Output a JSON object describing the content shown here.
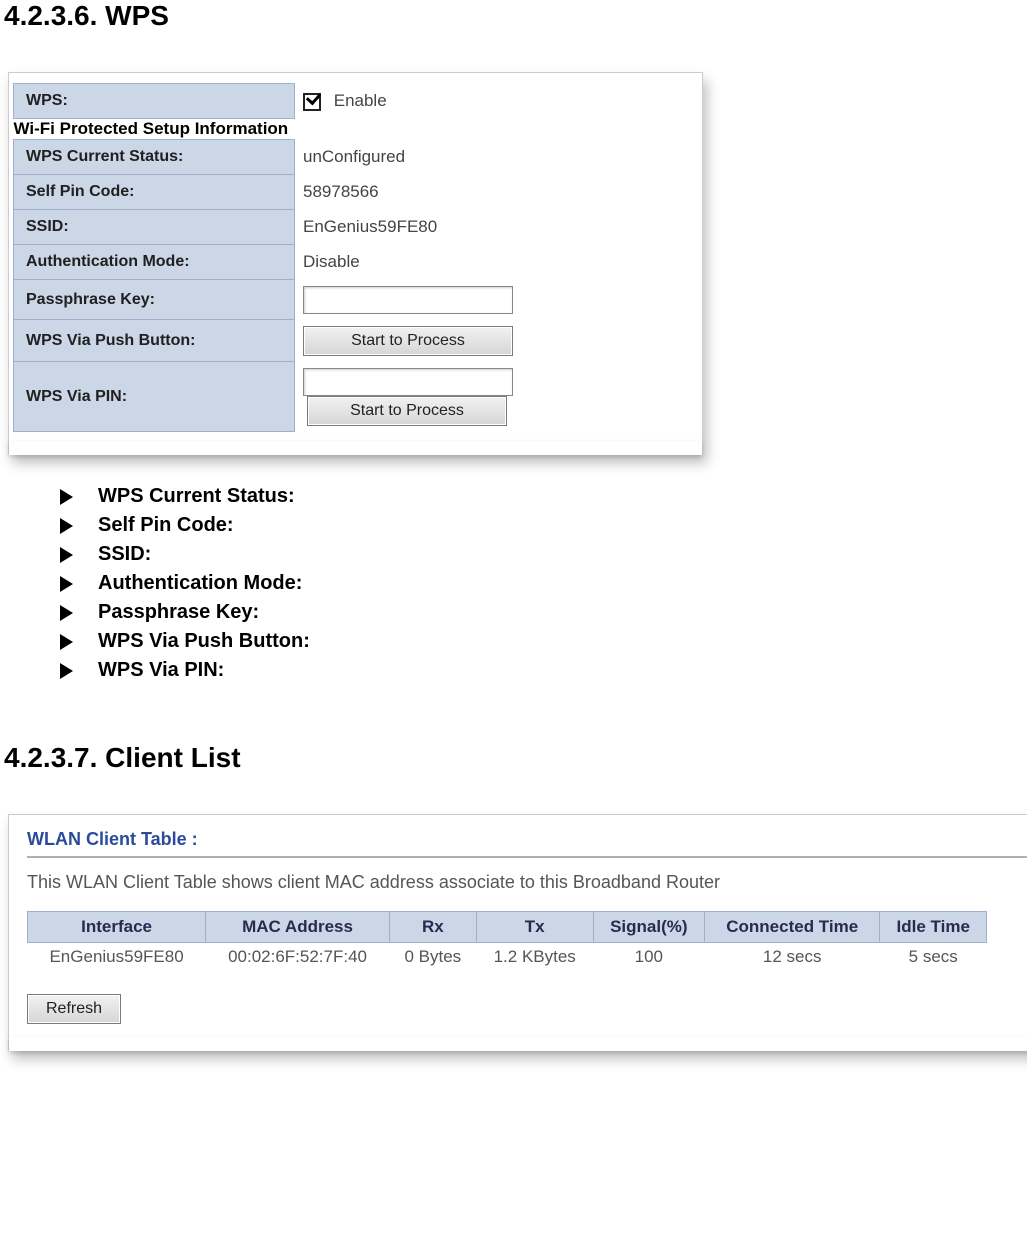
{
  "sec1": {
    "heading": "4.2.3.6.  WPS"
  },
  "wps": {
    "row_wps_label": "WPS:",
    "enable_label": "Enable",
    "enable_checked": true,
    "subheading": "Wi-Fi Protected Setup Information",
    "status_label": "WPS Current Status:",
    "status_value": "unConfigured",
    "pin_label": "Self Pin Code:",
    "pin_value": "58978566",
    "ssid_label": "SSID:",
    "ssid_value": "EnGenius59FE80",
    "auth_label": "Authentication Mode:",
    "auth_value": "Disable",
    "pass_label": "Passphrase Key:",
    "pass_value": "",
    "push_label": "WPS Via Push Button:",
    "push_btn": "Start to Process",
    "pinrow_label": "WPS Via PIN:",
    "pinrow_value": "",
    "pinrow_btn": "Start to Process"
  },
  "bullets": {
    "items": [
      "WPS Current Status:",
      "Self Pin Code:",
      "SSID:",
      "Authentication Mode:",
      "Passphrase Key:",
      "WPS Via Push Button:",
      "WPS Via PIN:"
    ]
  },
  "sec2": {
    "heading": "4.2.3.7.  Client List"
  },
  "client": {
    "title": "WLAN Client Table :",
    "desc": "This WLAN Client Table shows client MAC address associate to this Broadband Router",
    "headers": {
      "h0": "Interface",
      "h1": "MAC Address",
      "h2": "Rx",
      "h3": "Tx",
      "h4": "Signal(%)",
      "h5": "Connected Time",
      "h6": "Idle Time"
    },
    "row": {
      "c0": "EnGenius59FE80",
      "c1": "00:02:6F:52:7F:40",
      "c2": "0 Bytes",
      "c3": "1.2 KBytes",
      "c4": "100",
      "c5": "12 secs",
      "c6": "5 secs"
    },
    "refresh_btn": "Refresh"
  }
}
